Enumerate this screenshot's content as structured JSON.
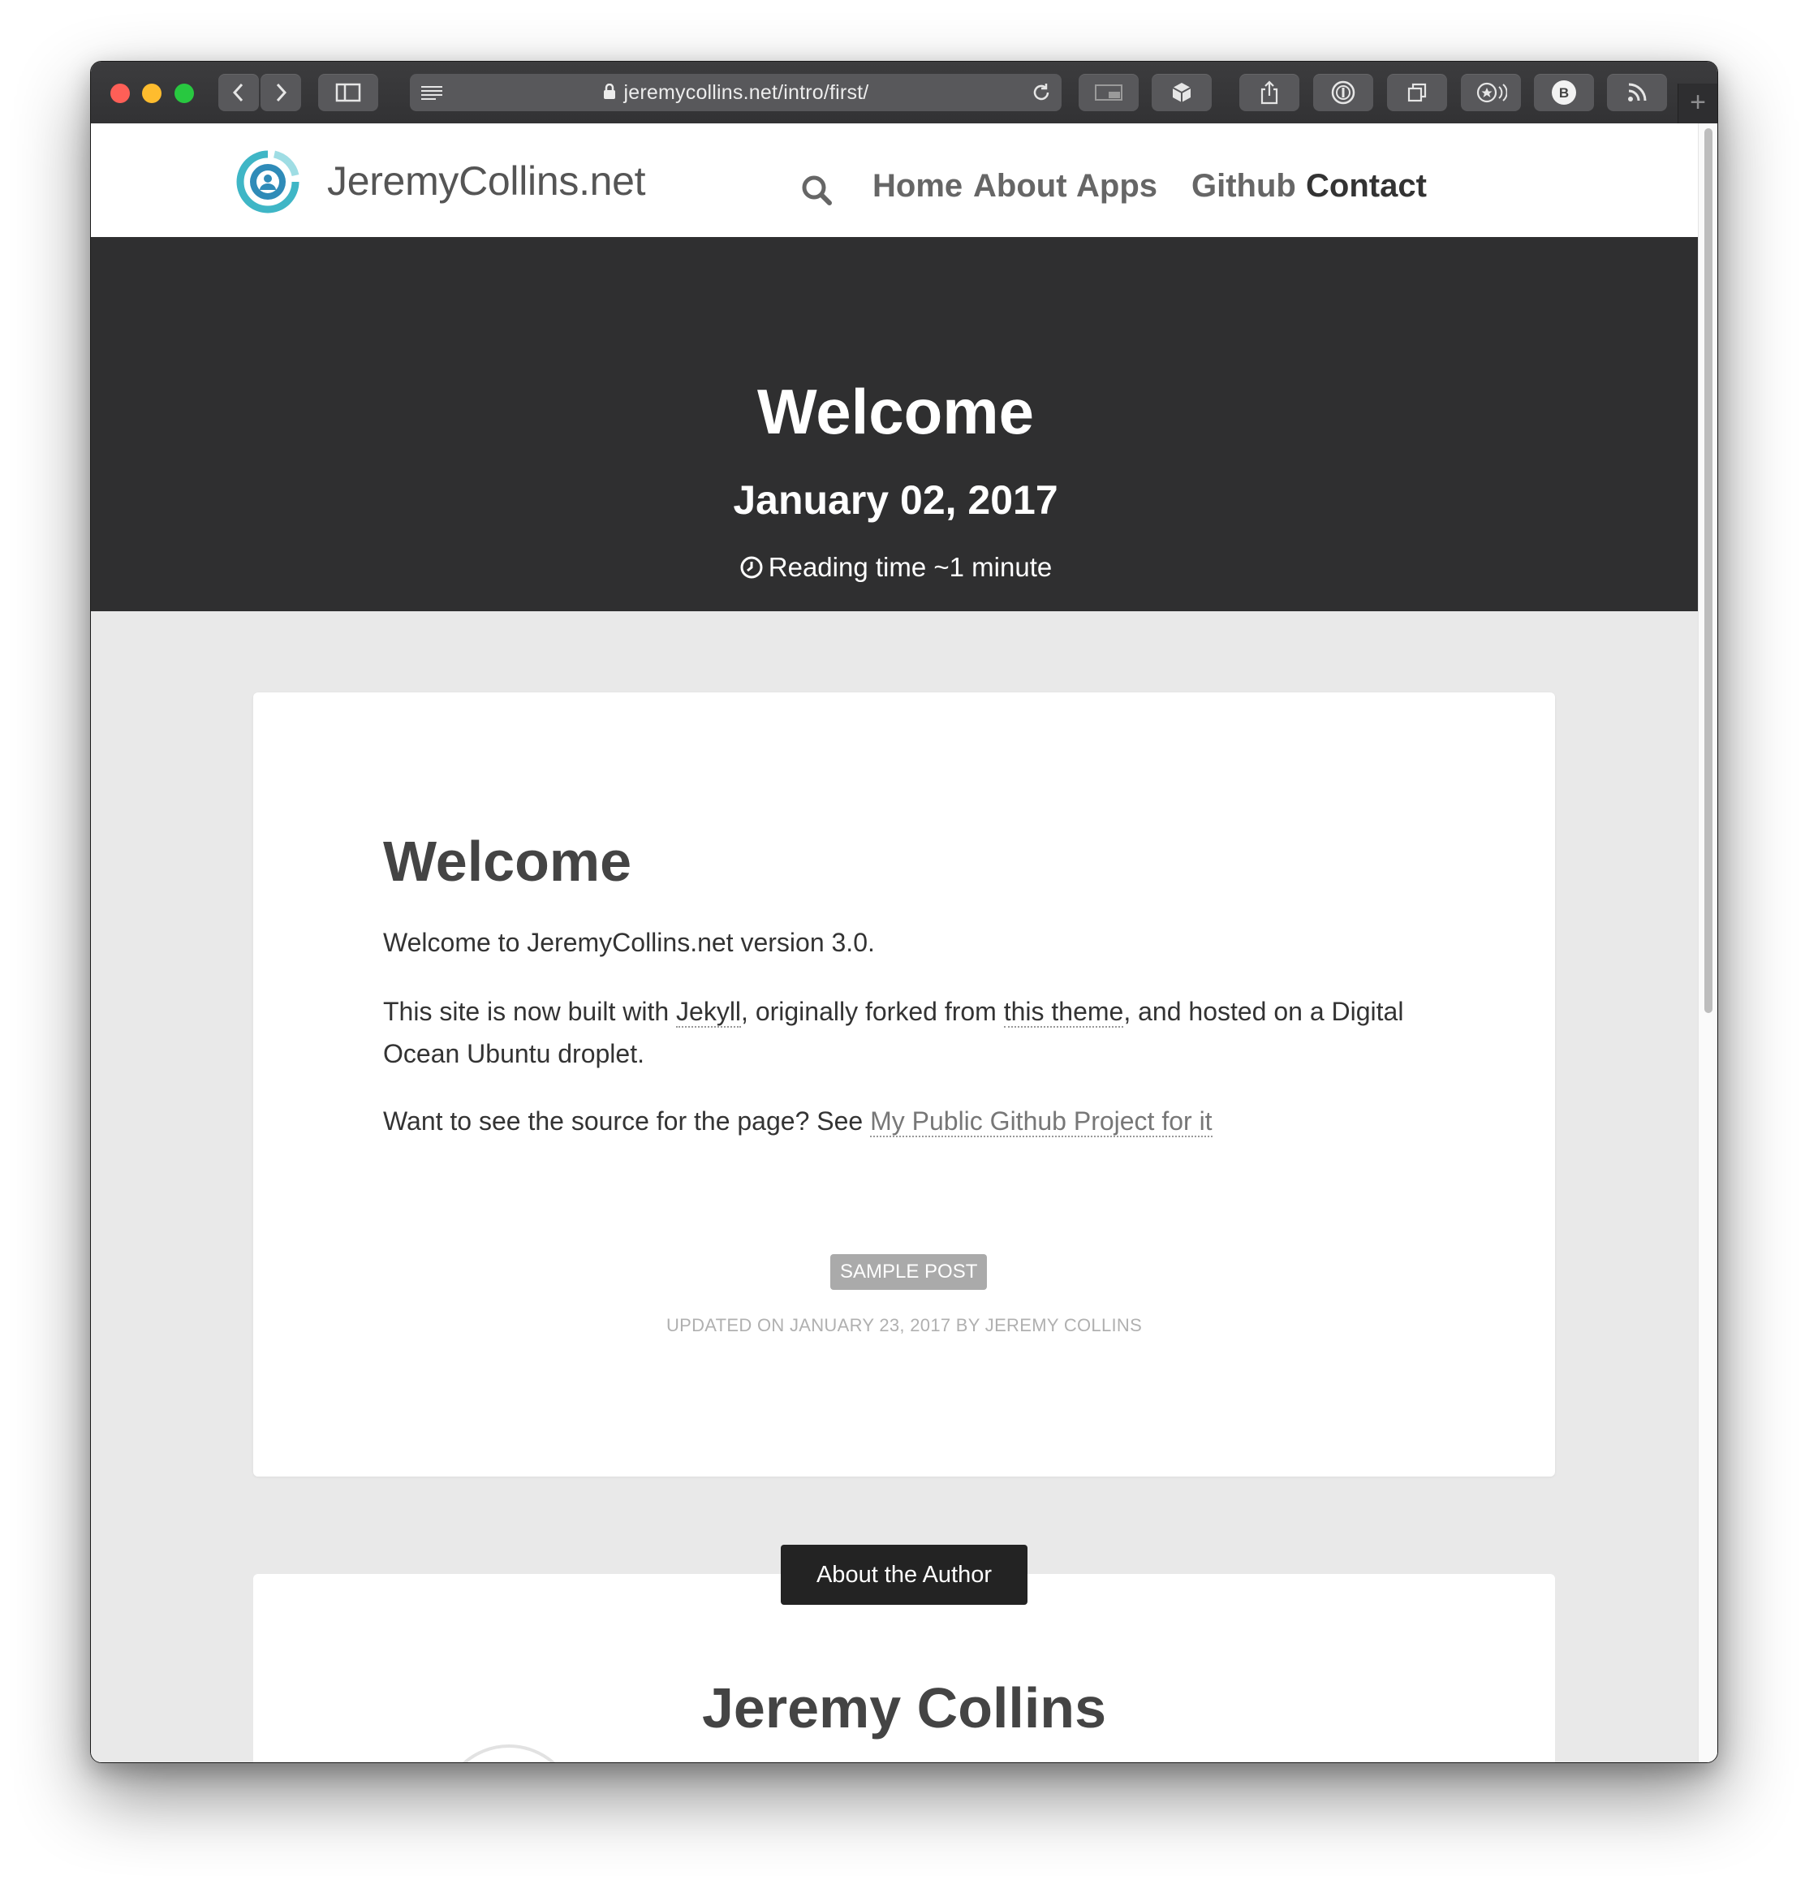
{
  "browser": {
    "url": "jeremycollins.net/intro/first/",
    "new_tab_symbol": "+"
  },
  "site": {
    "title": "JeremyCollins.net",
    "nav": [
      "Home",
      "About",
      "Apps",
      "Github",
      "Contact"
    ]
  },
  "hero": {
    "title": "Welcome",
    "date": "January 02, 2017",
    "reading_time": "Reading time ~1 minute"
  },
  "post": {
    "title": "Welcome",
    "p1": "Welcome to JeremyCollins.net version 3.0.",
    "p2_a": "This site is now built with ",
    "p2_link1": "Jekyll",
    "p2_b": ", originally forked from ",
    "p2_link2": "this theme",
    "p2_c": ", and hosted on a Digital Ocean Ubuntu droplet.",
    "p3_a": "Want to see the source for the page? See ",
    "p3_link": "My Public Github Project for it",
    "tag": "SAMPLE POST",
    "updated": "UPDATED ON JANUARY 23, 2017 BY JEREMY COLLINS"
  },
  "author": {
    "button": "About the Author",
    "name": "Jeremy Collins"
  },
  "colors": {
    "hero_bg": "#2f2f30",
    "page_bg": "#e9e9e9",
    "logo_teal": "#3fb6c6"
  }
}
